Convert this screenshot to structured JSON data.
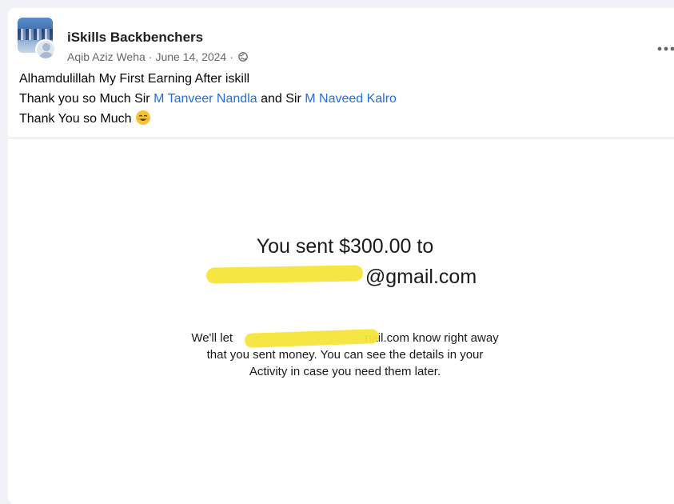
{
  "post": {
    "group_name": "iSkills Backbenchers",
    "author": "Aqib Aziz Weha",
    "separator": "·",
    "date": "June 14, 2024",
    "audience_icon": "globe-icon",
    "more_icon": "more-options-icon",
    "text": {
      "line1": "Alhamdulillah My First Earning After iskill",
      "line2_prefix": "Thank you so Much Sir ",
      "mention1": "M Tanveer Nandla",
      "line2_mid": " and Sir ",
      "mention2": "M Naveed Kalro",
      "line3": "Thank You so Much",
      "emoji": "smiling-face-emoji"
    }
  },
  "receipt": {
    "title_line1": "You sent $300.00 to",
    "title_line2_suffix": "@gmail.com",
    "body_line1_prefix": "We'll let",
    "body_line1_suffix": "nail.com know right away",
    "body_line2": "that you sent money. You can see the details in your",
    "body_line3": "Activity in case you need them later.",
    "redaction_color": "#f5e53a"
  },
  "colors": {
    "mention": "#216fdb",
    "background": "#f0f2f5"
  }
}
